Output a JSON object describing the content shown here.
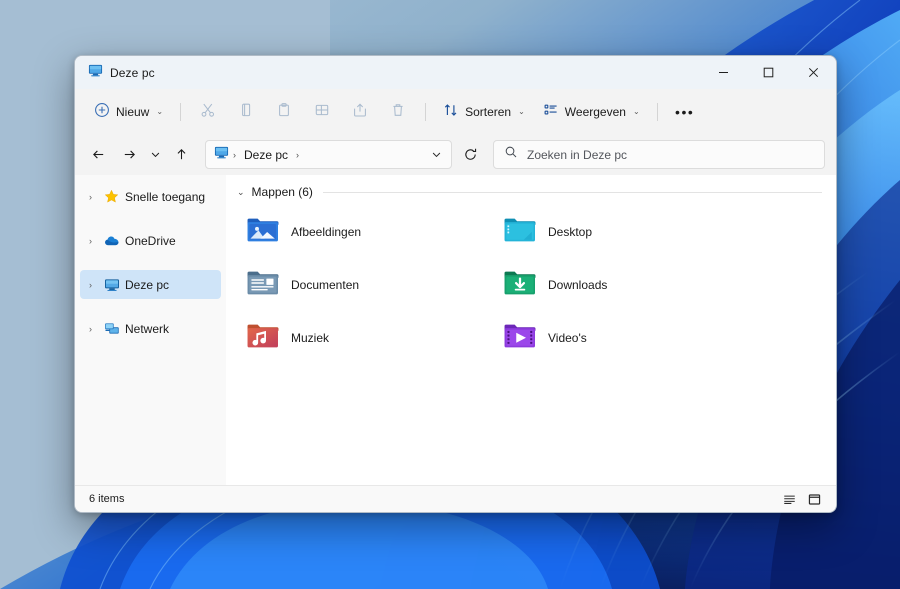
{
  "desktop": {
    "wallpaper_name": "windows-11-bloom-wallpaper",
    "colors": {
      "top_left": "#9fb9d0",
      "deep_blue": "#0b1f6b",
      "bright_blue": "#1b6ff0",
      "light_blue": "#56b3f5"
    }
  },
  "window": {
    "title": "Deze pc",
    "title_icon": "this-pc-icon",
    "controls": {
      "minimize": "—",
      "maximize": "□",
      "close": "✕"
    }
  },
  "toolbar": {
    "new_label": "Nieuw",
    "new_icon": "plus-circle-icon",
    "cut_label": "Knippen",
    "cut_icon": "scissors-icon",
    "copy_label": "Kopiëren",
    "copy_icon": "copy-icon",
    "paste_label": "Plakken",
    "paste_icon": "clipboard-icon",
    "rename_label": "Naam wijzigen",
    "rename_icon": "rename-icon",
    "share_label": "Delen",
    "share_icon": "share-icon",
    "delete_label": "Verwijderen",
    "delete_icon": "trash-icon",
    "sort_label": "Sorteren",
    "sort_icon": "sort-arrows-icon",
    "view_label": "Weergeven",
    "view_icon": "view-list-icon",
    "more_label": "•••",
    "more_icon": "ellipsis-icon",
    "chevron": "⌄"
  },
  "addressbar": {
    "back_icon": "arrow-left-icon",
    "forward_icon": "arrow-right-icon",
    "recent_icon": "chevron-down-icon",
    "up_icon": "arrow-up-icon",
    "path_icon": "this-pc-icon",
    "crumbs": [
      "Deze pc"
    ],
    "separator": "›",
    "dropdown_icon": "chevron-down-icon",
    "refresh_icon": "refresh-icon"
  },
  "search": {
    "icon": "search-icon",
    "placeholder": "Zoeken in Deze pc",
    "value": ""
  },
  "sidebar": {
    "items": [
      {
        "label": "Snelle toegang",
        "icon": "star-icon",
        "expander": "›",
        "selected": false
      },
      {
        "label": "OneDrive",
        "icon": "cloud-icon",
        "expander": "›",
        "selected": false
      },
      {
        "label": "Deze pc",
        "icon": "monitor-icon",
        "expander": "›",
        "selected": true
      },
      {
        "label": "Netwerk",
        "icon": "network-icon",
        "expander": "›",
        "selected": false
      }
    ]
  },
  "main": {
    "group_title": "Mappen (6)",
    "group_chevron": "⌄",
    "folders": [
      {
        "label": "Afbeeldingen",
        "icon": "pictures-folder-icon",
        "color": "#2b6fd4"
      },
      {
        "label": "Desktop",
        "icon": "desktop-folder-icon",
        "color": "#1fb6d6"
      },
      {
        "label": "Documenten",
        "icon": "documents-folder-icon",
        "color": "#5b7f9e"
      },
      {
        "label": "Downloads",
        "icon": "downloads-folder-icon",
        "color": "#18a673"
      },
      {
        "label": "Muziek",
        "icon": "music-folder-icon",
        "color": "#d9534f"
      },
      {
        "label": "Video's",
        "icon": "videos-folder-icon",
        "color": "#8b3fd4"
      }
    ]
  },
  "statusbar": {
    "item_count": "6 items",
    "details_view_icon": "details-view-icon",
    "large_icons_view_icon": "large-icons-view-icon"
  }
}
